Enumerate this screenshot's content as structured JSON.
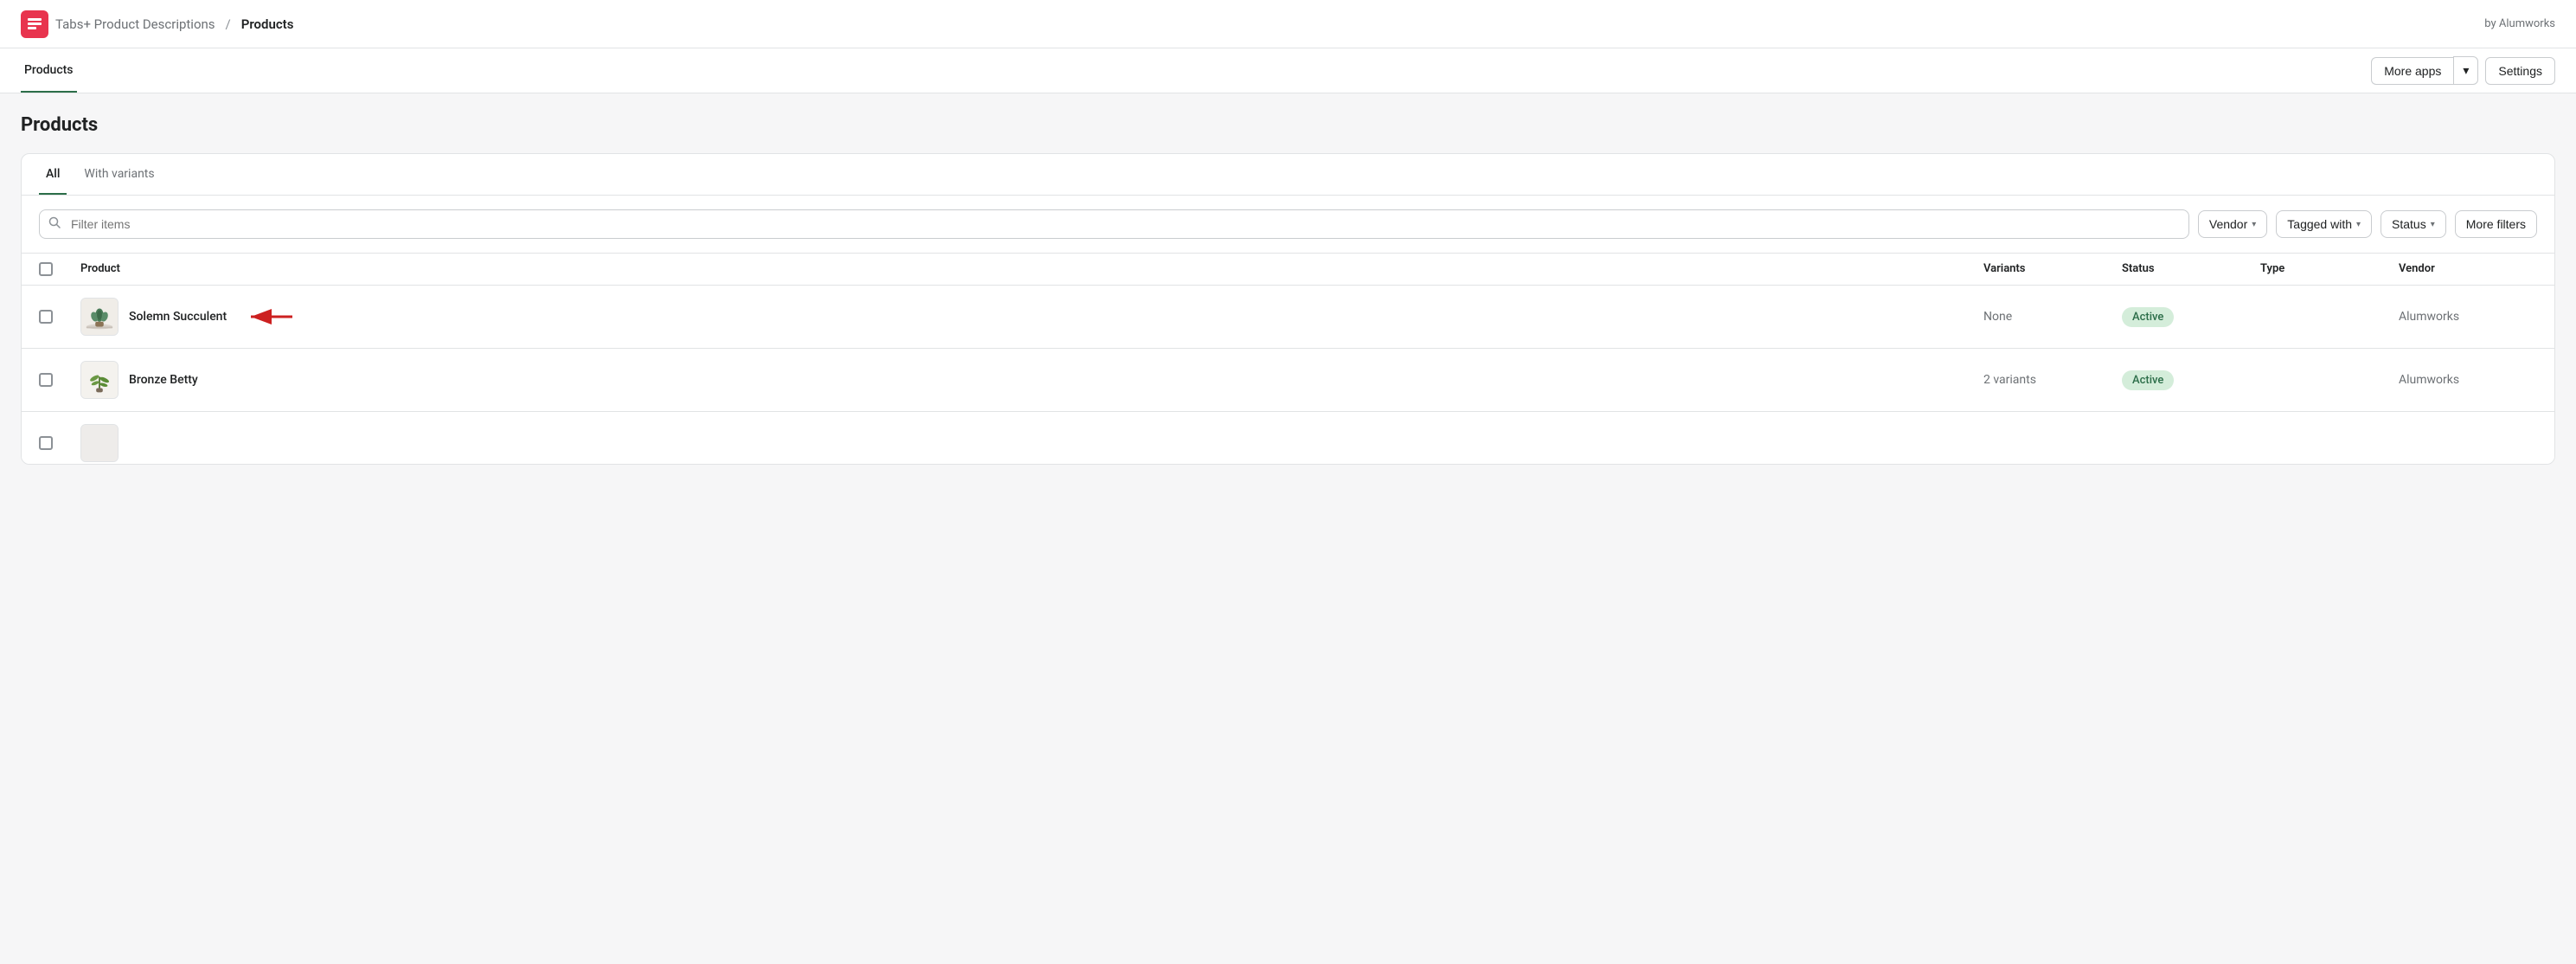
{
  "topNav": {
    "appName": "Tabs+ Product Descriptions",
    "separator": "/",
    "currentPage": "Products",
    "byline": "by Alumworks"
  },
  "tabBar": {
    "tab": "Products",
    "buttons": {
      "moreApps": "More apps",
      "settings": "Settings"
    }
  },
  "page": {
    "title": "Products"
  },
  "cardTabs": [
    {
      "label": "All",
      "active": true
    },
    {
      "label": "With variants",
      "active": false
    }
  ],
  "filterBar": {
    "searchPlaceholder": "Filter items",
    "filters": [
      {
        "label": "Vendor",
        "id": "vendor-filter"
      },
      {
        "label": "Tagged with",
        "id": "tagged-with-filter"
      },
      {
        "label": "Status",
        "id": "status-filter"
      },
      {
        "label": "More filters",
        "id": "more-filters"
      }
    ]
  },
  "table": {
    "columns": [
      {
        "label": ""
      },
      {
        "label": "Product"
      },
      {
        "label": "Variants"
      },
      {
        "label": "Status"
      },
      {
        "label": "Type"
      },
      {
        "label": "Vendor"
      }
    ],
    "rows": [
      {
        "id": "solemn-succulent",
        "product": "Solemn Succulent",
        "hasArrow": true,
        "variants": "None",
        "status": "Active",
        "type": "",
        "vendor": "Alumworks"
      },
      {
        "id": "bronze-betty",
        "product": "Bronze Betty",
        "hasArrow": false,
        "variants": "2 variants",
        "status": "Active",
        "type": "",
        "vendor": "Alumworks"
      }
    ]
  },
  "icons": {
    "search": "🔍",
    "chevronDown": "▾",
    "chevronRight": "›"
  },
  "colors": {
    "activeTabBorder": "#2c6e49",
    "activeBadge": "#d4edda",
    "activeBadgeText": "#2c6e49"
  }
}
